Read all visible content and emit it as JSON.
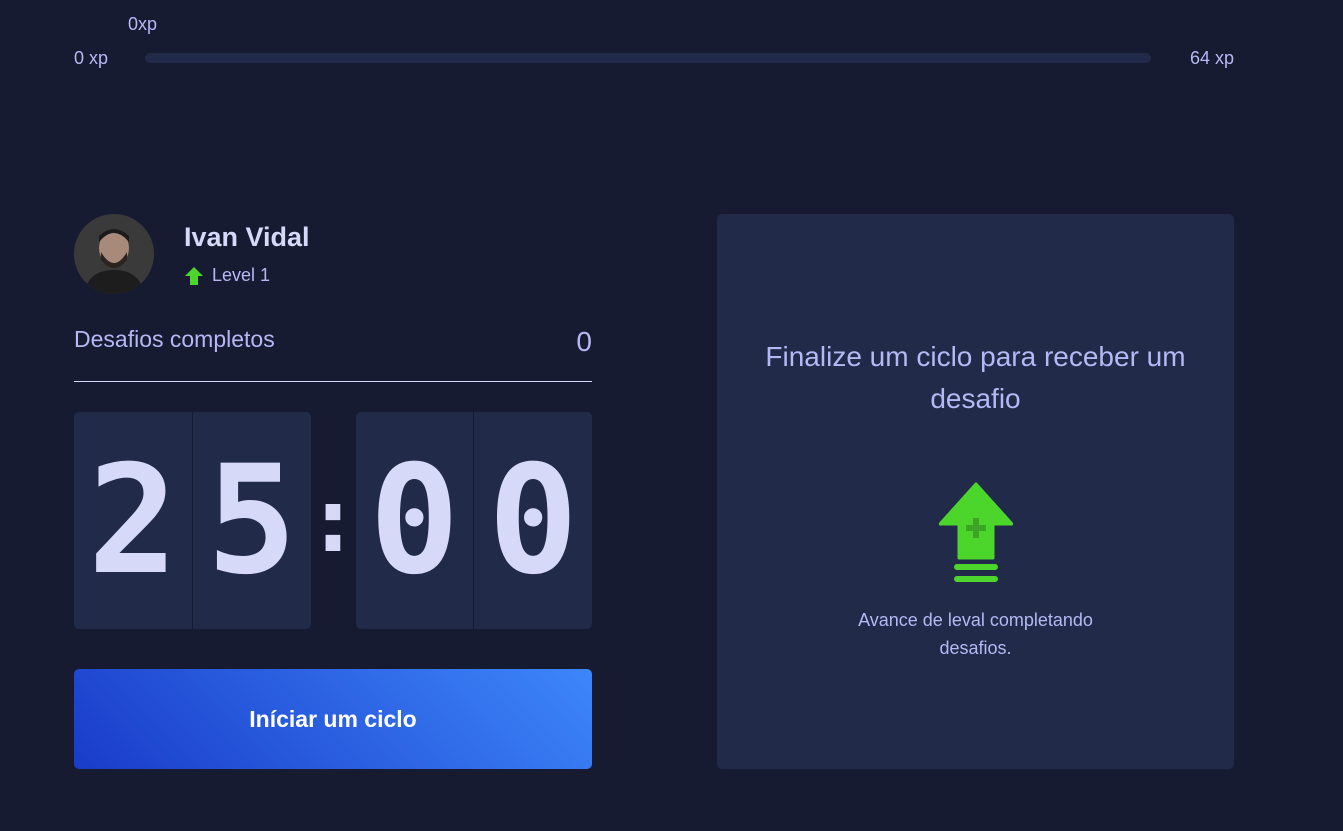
{
  "experience": {
    "current": "0xp",
    "min": "0 xp",
    "max": "64 xp",
    "progress_percent": 0
  },
  "profile": {
    "name": "Ivan Vidal",
    "level_label": "Level 1",
    "avatar_icon": "avatar-photo",
    "level_icon": "arrow-up-icon"
  },
  "challenges": {
    "label": "Desafios completos",
    "count": "0"
  },
  "countdown": {
    "minute_left": "2",
    "minute_right": "5",
    "separator": ":",
    "second_left": "0",
    "second_right": "0"
  },
  "start_button": {
    "label": "Iníciar um ciclo"
  },
  "challenge_card": {
    "title": "Finalize um ciclo para receber um desafio",
    "text": "Avance de leval completando desafios.",
    "icon": "level-up-icon"
  },
  "colors": {
    "background": "#171b31",
    "panel": "#212a48",
    "text": "#b5b8f5",
    "accent_green": "#4cd62b",
    "button_start": "#1a3cc9",
    "button_end": "#3d86fa"
  }
}
